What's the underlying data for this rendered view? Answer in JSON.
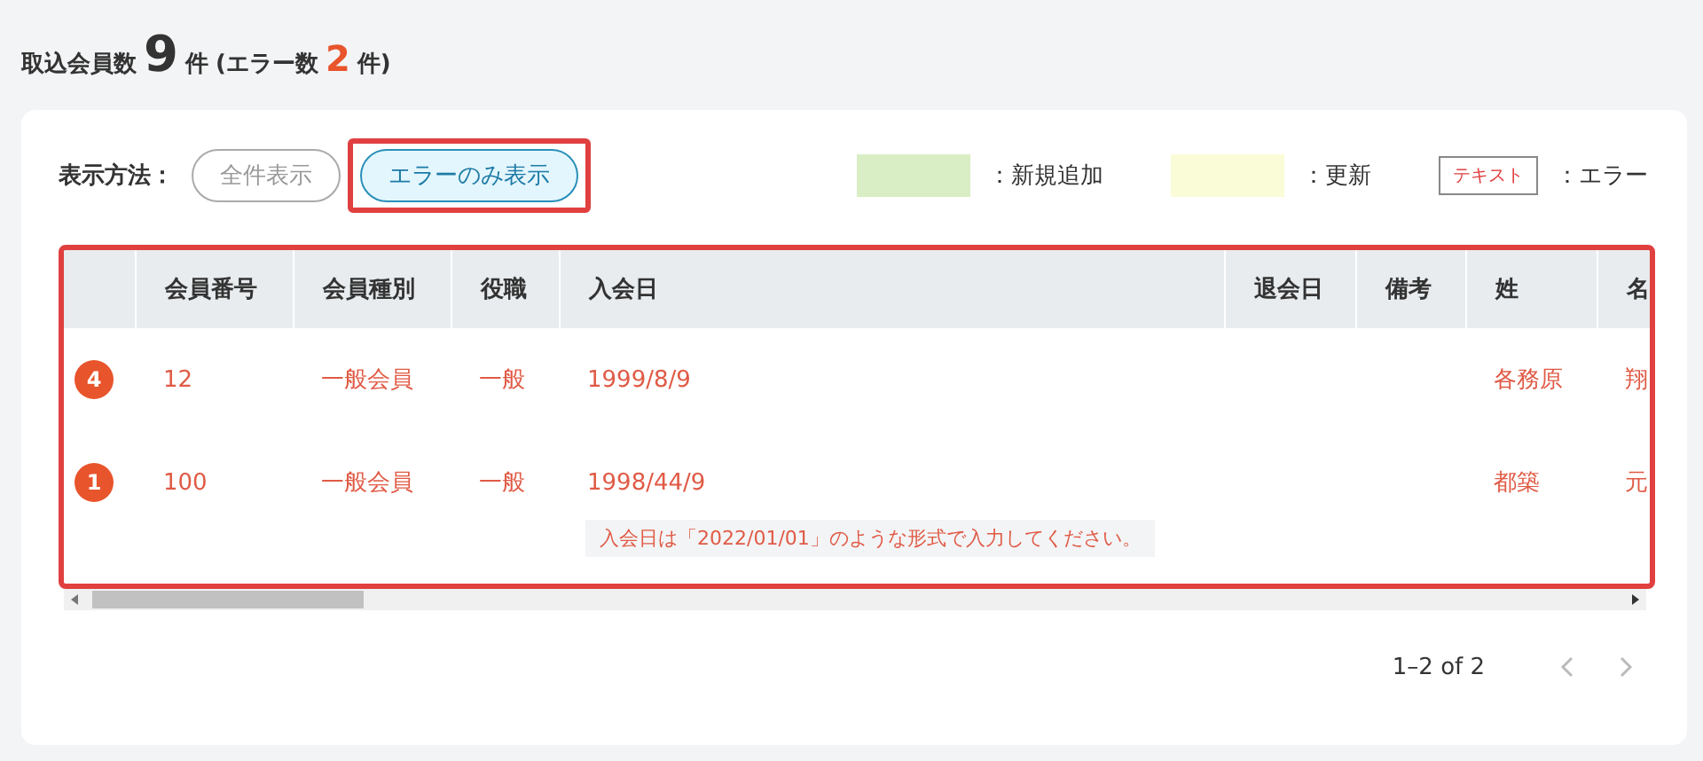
{
  "summary": {
    "label": "取込会員数",
    "total": "9",
    "total_unit": "件",
    "error_label": "(エラー数",
    "errors": "2",
    "error_unit": "件)"
  },
  "filter": {
    "label": "表示方法：",
    "options": [
      {
        "label": "全件表示",
        "selected": false
      },
      {
        "label": "エラーのみ表示",
        "selected": true
      }
    ]
  },
  "legend": [
    {
      "kind": "swatch",
      "color": "#d9eec4",
      "label": "：新規追加"
    },
    {
      "kind": "swatch",
      "color": "#fafcd8",
      "label": "：更新"
    },
    {
      "kind": "sample",
      "sample": "テキスト",
      "label": "：エラー"
    }
  ],
  "table": {
    "columns": [
      "",
      "会員番号",
      "会員種別",
      "役職",
      "入会日",
      "退会日",
      "備考",
      "姓",
      "名"
    ],
    "rows": [
      {
        "cells": [
          "4",
          "12",
          "一般会員",
          "一般",
          "1999/8/9",
          "",
          "",
          "各務原",
          "翔"
        ]
      },
      {
        "cells": [
          "1",
          "100",
          "一般会員",
          "一般",
          "1998/44/9",
          "",
          "",
          "都築",
          "元"
        ],
        "message": "入会日は「2022/01/01」のような形式で入力してください。"
      }
    ]
  },
  "pagination": {
    "range": "1–2 of 2",
    "prev_disabled": true,
    "next_disabled": true
  }
}
